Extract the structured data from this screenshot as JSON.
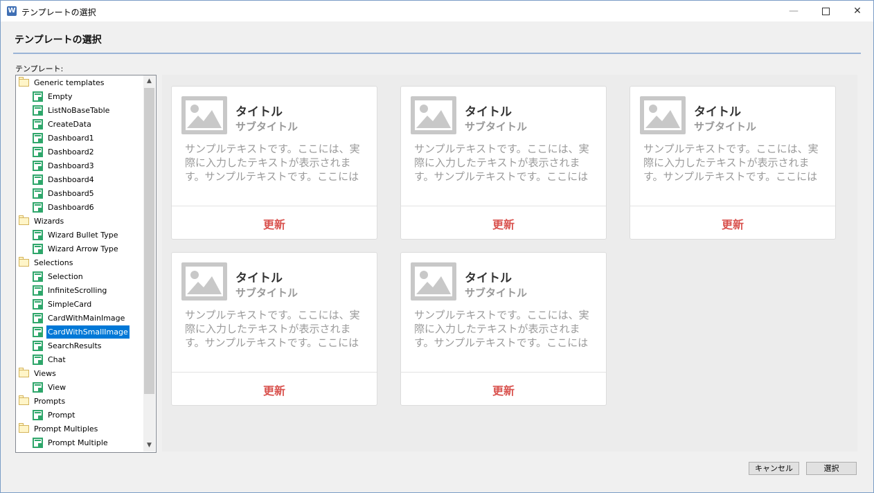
{
  "window": {
    "title": "テンプレートの選択",
    "min_glyph": "—",
    "close_glyph": "✕",
    "icon": "app-logo-icon"
  },
  "header": {
    "title": "テンプレートの選択"
  },
  "tree": {
    "label": "テンプレート:",
    "items": [
      {
        "label": "Generic templates",
        "type": "folder"
      },
      {
        "label": "Empty",
        "type": "item"
      },
      {
        "label": "ListNoBaseTable",
        "type": "item"
      },
      {
        "label": "CreateData",
        "type": "item"
      },
      {
        "label": "Dashboard1",
        "type": "item"
      },
      {
        "label": "Dashboard2",
        "type": "item"
      },
      {
        "label": "Dashboard3",
        "type": "item"
      },
      {
        "label": "Dashboard4",
        "type": "item"
      },
      {
        "label": "Dashboard5",
        "type": "item"
      },
      {
        "label": "Dashboard6",
        "type": "item"
      },
      {
        "label": "Wizards",
        "type": "folder"
      },
      {
        "label": "Wizard Bullet Type",
        "type": "item"
      },
      {
        "label": "Wizard Arrow Type",
        "type": "item"
      },
      {
        "label": "Selections",
        "type": "folder"
      },
      {
        "label": "Selection",
        "type": "item"
      },
      {
        "label": "InfiniteScrolling",
        "type": "item"
      },
      {
        "label": "SimpleCard",
        "type": "item"
      },
      {
        "label": "CardWithMainImage",
        "type": "item"
      },
      {
        "label": "CardWithSmallImage",
        "type": "item",
        "selected": true
      },
      {
        "label": "SearchResults",
        "type": "item"
      },
      {
        "label": "Chat",
        "type": "item"
      },
      {
        "label": "Views",
        "type": "folder"
      },
      {
        "label": "View",
        "type": "item"
      },
      {
        "label": "Prompts",
        "type": "folder"
      },
      {
        "label": "Prompt",
        "type": "item"
      },
      {
        "label": "Prompt Multiples",
        "type": "folder"
      },
      {
        "label": "Prompt Multiple",
        "type": "item"
      }
    ],
    "scroll_up_glyph": "▲",
    "scroll_down_glyph": "▼"
  },
  "cards": [
    {
      "title": "タイトル",
      "subtitle": "サブタイトル",
      "body": "サンプルテキストです。ここには、実際に入力したテキストが表示されます。サンプルテキストです。ここには",
      "action": "更新"
    },
    {
      "title": "タイトル",
      "subtitle": "サブタイトル",
      "body": "サンプルテキストです。ここには、実際に入力したテキストが表示されます。サンプルテキストです。ここには",
      "action": "更新"
    },
    {
      "title": "タイトル",
      "subtitle": "サブタイトル",
      "body": "サンプルテキストです。ここには、実際に入力したテキストが表示されます。サンプルテキストです。ここには",
      "action": "更新"
    },
    {
      "title": "タイトル",
      "subtitle": "サブタイトル",
      "body": "サンプルテキストです。ここには、実際に入力したテキストが表示されます。サンプルテキストです。ここには",
      "action": "更新"
    },
    {
      "title": "タイトル",
      "subtitle": "サブタイトル",
      "body": "サンプルテキストです。ここには、実際に入力したテキストが表示されます。サンプルテキストです。ここには",
      "action": "更新"
    }
  ],
  "footer": {
    "cancel_label": "キャンセル",
    "select_label": "選択"
  },
  "colors": {
    "accent_red": "#d9534f",
    "selection_blue": "#0078d7",
    "icon_green": "#2ea66a"
  }
}
